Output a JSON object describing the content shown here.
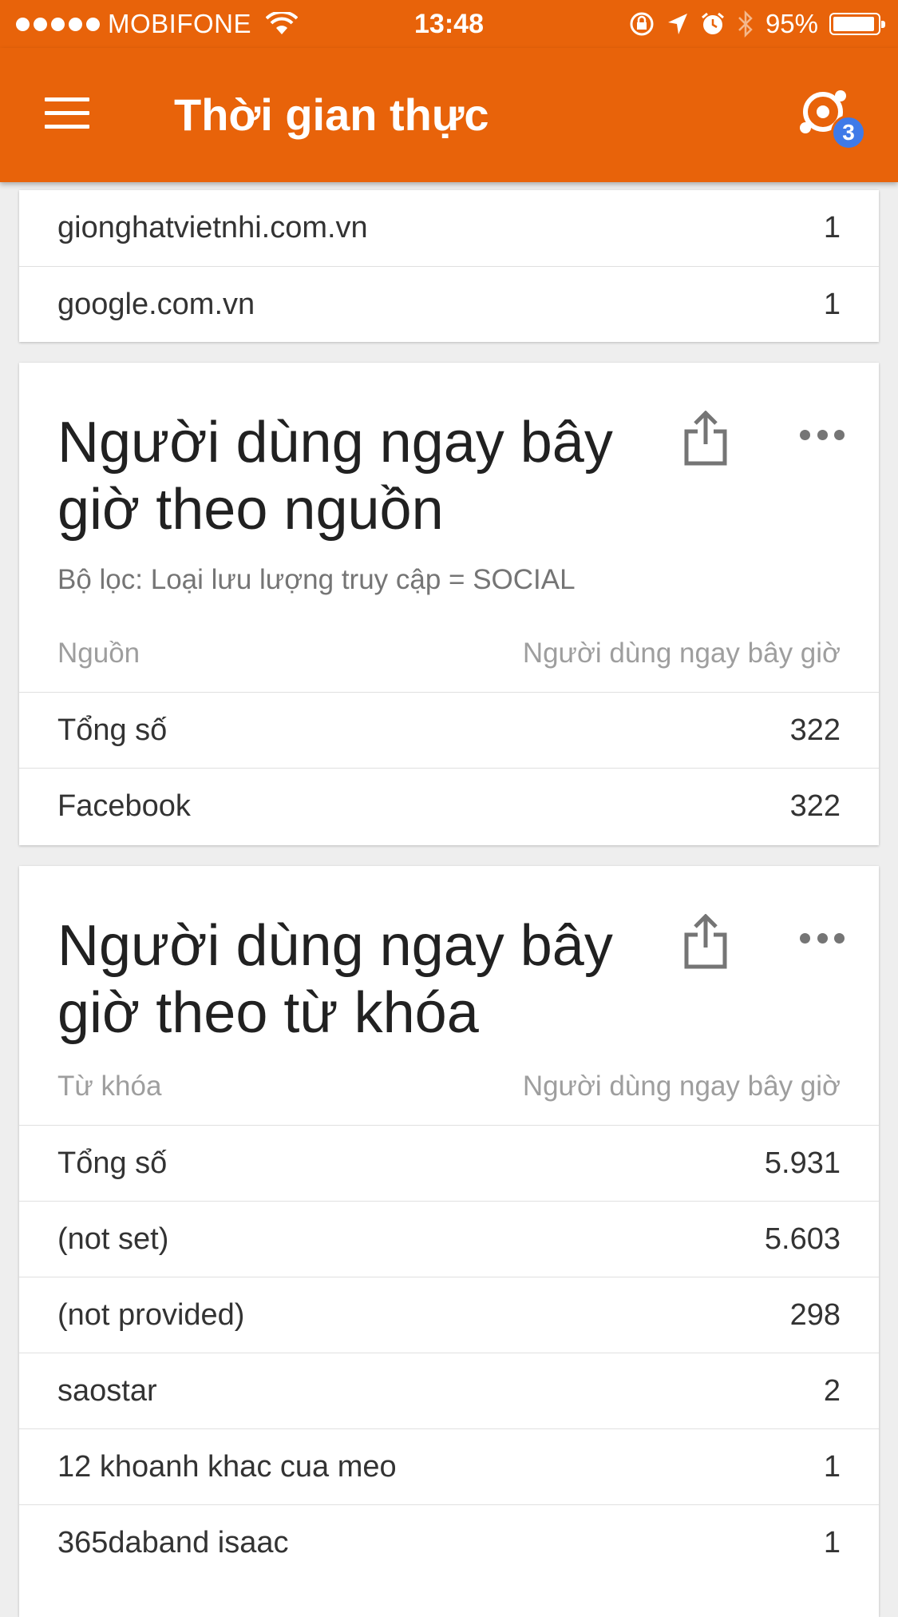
{
  "status_bar": {
    "carrier": "MOBIFONE",
    "time": "13:48",
    "battery": "95%",
    "battery_level": 0.95
  },
  "app_bar": {
    "title": "Thời gian thực",
    "realtime_badge": "3"
  },
  "colors": {
    "brand": "#e8630a",
    "badge": "#3f7ae8"
  },
  "referral_card": {
    "rows": [
      {
        "label": "gionghatvietnhi.com.vn",
        "value": "1"
      },
      {
        "label": "google.com.vn",
        "value": "1"
      }
    ]
  },
  "source_card": {
    "title": "Người dùng ngay bây giờ theo nguồn",
    "filter": "Bộ lọc: Loại lưu lượng truy cập = SOCIAL",
    "col_left": "Nguồn",
    "col_right": "Người dùng ngay bây giờ",
    "rows": [
      {
        "label": "Tổng số",
        "value": "322"
      },
      {
        "label": "Facebook",
        "value": "322"
      }
    ]
  },
  "keyword_card": {
    "title": "Người dùng ngay bây giờ theo từ khóa",
    "col_left": "Từ khóa",
    "col_right": "Người dùng ngay bây giờ",
    "rows": [
      {
        "label": "Tổng số",
        "value": "5.931"
      },
      {
        "label": "(not set)",
        "value": "5.603"
      },
      {
        "label": "(not provided)",
        "value": "298"
      },
      {
        "label": "saostar",
        "value": "2"
      },
      {
        "label": "12 khoanh khac cua meo",
        "value": "1"
      },
      {
        "label": "365daband isaac",
        "value": "1"
      }
    ]
  }
}
